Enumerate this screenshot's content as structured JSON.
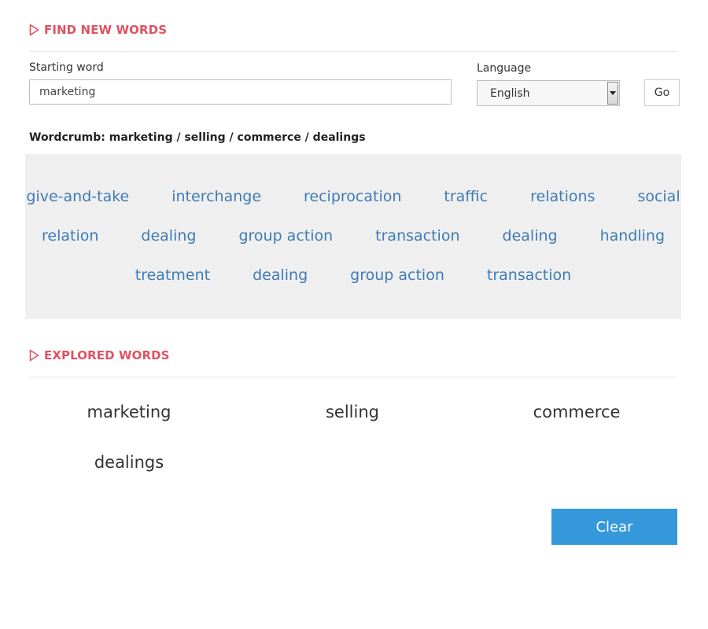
{
  "find_section": {
    "heading": "FIND NEW WORDS",
    "starting_word_label": "Starting word",
    "starting_word_value": "marketing",
    "language_label": "Language",
    "language_value": "English",
    "go_label": "Go"
  },
  "wordcrumb": "Wordcrumb: marketing / selling / commerce / dealings",
  "related_words": {
    "row1": [
      "give-and-take",
      "interchange",
      "reciprocation",
      "traffic",
      "relations",
      "social"
    ],
    "row2": [
      "relation",
      "dealing",
      "group action",
      "transaction",
      "dealing",
      "handling"
    ],
    "row3": [
      "treatment",
      "dealing",
      "group action",
      "transaction"
    ]
  },
  "explored_section": {
    "heading": "EXPLORED WORDS",
    "words": [
      "marketing",
      "selling",
      "commerce",
      "dealings"
    ],
    "clear_label": "Clear"
  },
  "colors": {
    "heading_accent": "#e05260",
    "link": "#3e7cb5",
    "panel_background": "#efefef",
    "button_primary": "#3498db"
  },
  "icons": {
    "section_heading": "play-triangle-outline-icon",
    "select_arrow": "caret-down-icon"
  }
}
